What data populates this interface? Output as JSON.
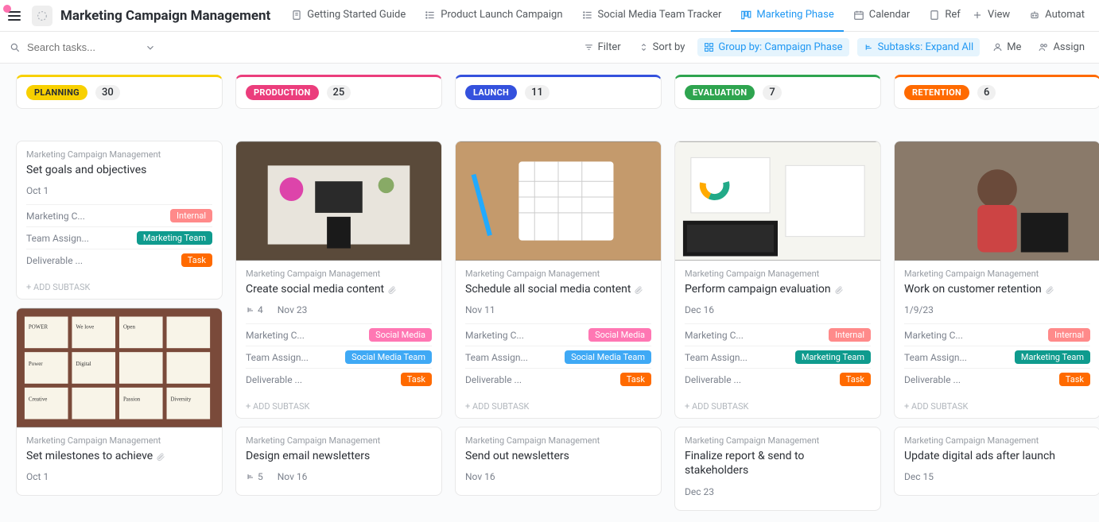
{
  "header": {
    "title": "Marketing Campaign Management",
    "tabs": [
      {
        "label": "Getting Started Guide",
        "icon": "doc"
      },
      {
        "label": "Product Launch Campaign",
        "icon": "list"
      },
      {
        "label": "Social Media Team Tracker",
        "icon": "list"
      },
      {
        "label": "Marketing Phase",
        "icon": "board",
        "active": true
      },
      {
        "label": "Calendar",
        "icon": "calendar"
      },
      {
        "label": "Ref",
        "icon": "doc"
      }
    ],
    "right_tabs": [
      {
        "label": "View",
        "icon": "plus"
      },
      {
        "label": "Automat",
        "icon": "robot"
      }
    ]
  },
  "toolbar": {
    "search_placeholder": "Search tasks...",
    "filter": "Filter",
    "sort": "Sort by",
    "group": "Group by: Campaign Phase",
    "subtasks": "Subtasks: Expand All",
    "me": "Me",
    "assign": "Assign"
  },
  "columns": [
    {
      "id": "planning",
      "label": "PLANNING",
      "count": "30",
      "color": "#f8d000",
      "textColor": "#2a2e34"
    },
    {
      "id": "production",
      "label": "PRODUCTION",
      "count": "25",
      "color": "#eb3d7c"
    },
    {
      "id": "launch",
      "label": "LAUNCH",
      "count": "11",
      "color": "#3451dd"
    },
    {
      "id": "evaluation",
      "label": "EVALUATION",
      "count": "7",
      "color": "#2ea44f"
    },
    {
      "id": "retention",
      "label": "RETENTION",
      "count": "6",
      "color": "#ff6a00"
    }
  ],
  "cards": {
    "planning": [
      {
        "project": "Marketing Campaign Management",
        "title": "Set goals and objectives",
        "date": "Oct 1",
        "rows": [
          {
            "k": "Marketing C...",
            "v": "Internal",
            "c": "#ff8a8a"
          },
          {
            "k": "Team Assign...",
            "v": "Marketing Team",
            "c": "#0f9b8e"
          },
          {
            "k": "Deliverable ...",
            "v": "Task",
            "c": "#ff6a00"
          }
        ],
        "add": "+ ADD SUBTASK"
      },
      {
        "img": "notes",
        "project": "Marketing Campaign Management",
        "title": "Set milestones to achieve",
        "attach": true,
        "date": "Oct 1"
      }
    ],
    "production": [
      {
        "img": "desk",
        "project": "Marketing Campaign Management",
        "title": "Create social media content",
        "attach": true,
        "subtasks": "4",
        "date": "Nov 23",
        "rows": [
          {
            "k": "Marketing C...",
            "v": "Social Media",
            "c": "#ff77b3"
          },
          {
            "k": "Team Assign...",
            "v": "Social Media Team",
            "c": "#3fa9f5"
          },
          {
            "k": "Deliverable ...",
            "v": "Task",
            "c": "#ff6a00"
          }
        ],
        "add": "+ ADD SUBTASK"
      },
      {
        "project": "Marketing Campaign Management",
        "title": "Design email newsletters",
        "subtasks": "5",
        "date": "Nov 16"
      }
    ],
    "launch": [
      {
        "img": "calendar",
        "project": "Marketing Campaign Management",
        "title": "Schedule all social media content",
        "attach": true,
        "date": "Nov 11",
        "rows": [
          {
            "k": "Marketing C...",
            "v": "Social Media",
            "c": "#ff77b3"
          },
          {
            "k": "Team Assign...",
            "v": "Social Media Team",
            "c": "#3fa9f5"
          },
          {
            "k": "Deliverable ...",
            "v": "Task",
            "c": "#ff6a00"
          }
        ],
        "add": "+ ADD SUBTASK"
      },
      {
        "project": "Marketing Campaign Management",
        "title": "Send out newsletters",
        "date": "Nov 16"
      }
    ],
    "evaluation": [
      {
        "img": "charts",
        "project": "Marketing Campaign Management",
        "title": "Perform campaign evaluation",
        "attach": true,
        "date": "Dec 16",
        "rows": [
          {
            "k": "Marketing C...",
            "v": "Internal",
            "c": "#ff8a8a"
          },
          {
            "k": "Team Assign...",
            "v": "Marketing Team",
            "c": "#0f9b8e"
          },
          {
            "k": "Deliverable ...",
            "v": "Task",
            "c": "#ff6a00"
          }
        ],
        "add": "+ ADD SUBTASK"
      },
      {
        "project": "Marketing Campaign Management",
        "title": "Finalize report & send to stakeholders",
        "date": "Dec 23"
      }
    ],
    "retention": [
      {
        "img": "person",
        "project": "Marketing Campaign Management",
        "title": "Work on customer retention",
        "attach": true,
        "date": "1/9/23",
        "rows": [
          {
            "k": "Marketing C...",
            "v": "Internal",
            "c": "#ff8a8a"
          },
          {
            "k": "Team Assign...",
            "v": "Marketing Team",
            "c": "#0f9b8e"
          },
          {
            "k": "Deliverable ...",
            "v": "Task",
            "c": "#ff6a00"
          }
        ],
        "add": "+ ADD SUBTASK"
      },
      {
        "project": "Marketing Campaign Management",
        "title": "Update digital ads after launch",
        "date": "Dec 15"
      }
    ]
  }
}
